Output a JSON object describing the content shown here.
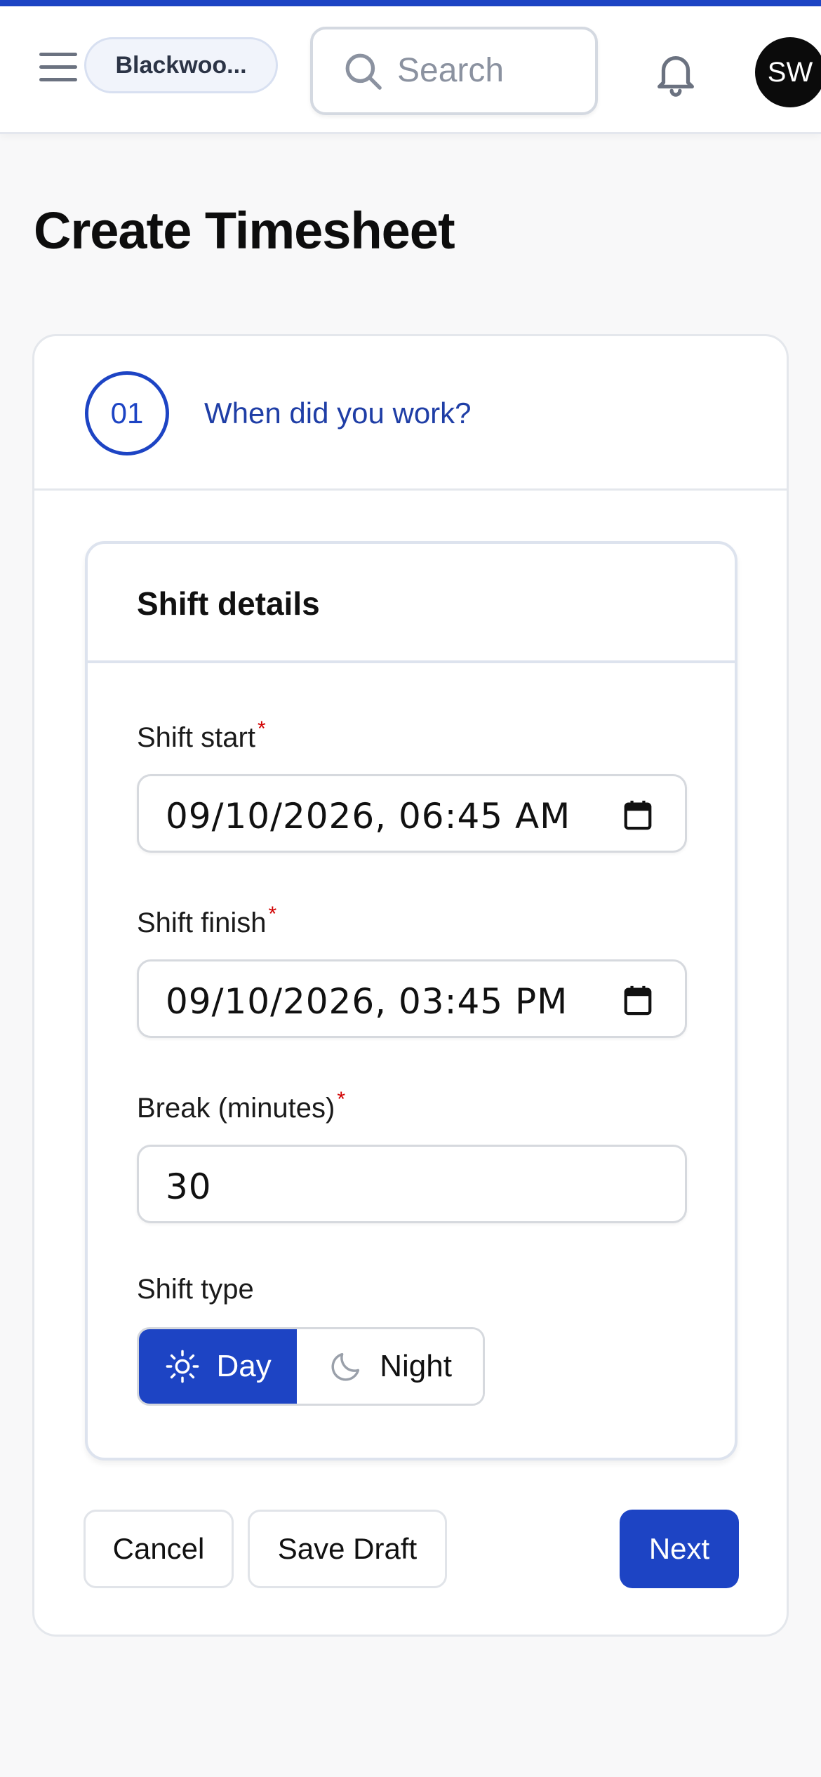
{
  "header": {
    "org_name": "Blackwoo...",
    "search_placeholder": "Search",
    "avatar_initials": "SW"
  },
  "page": {
    "title": "Create Timesheet"
  },
  "step": {
    "number": "01",
    "title": "When did you work?"
  },
  "shift_details": {
    "title": "Shift details",
    "shift_start": {
      "label": "Shift start",
      "value": "09/10/2026, 06:45 AM",
      "required": "*"
    },
    "shift_finish": {
      "label": "Shift finish",
      "value": "09/10/2026, 03:45 PM",
      "required": "*"
    },
    "break_minutes": {
      "label": "Break (minutes)",
      "value": "30",
      "required": "*"
    },
    "shift_type": {
      "label": "Shift type",
      "options": [
        {
          "label": "Day",
          "icon": "sun-icon",
          "selected": true
        },
        {
          "label": "Night",
          "icon": "moon-icon",
          "selected": false
        }
      ]
    }
  },
  "actions": {
    "cancel": "Cancel",
    "save_draft": "Save Draft",
    "next": "Next"
  },
  "colors": {
    "accent": "#1d44c4",
    "required": "#d10000"
  }
}
